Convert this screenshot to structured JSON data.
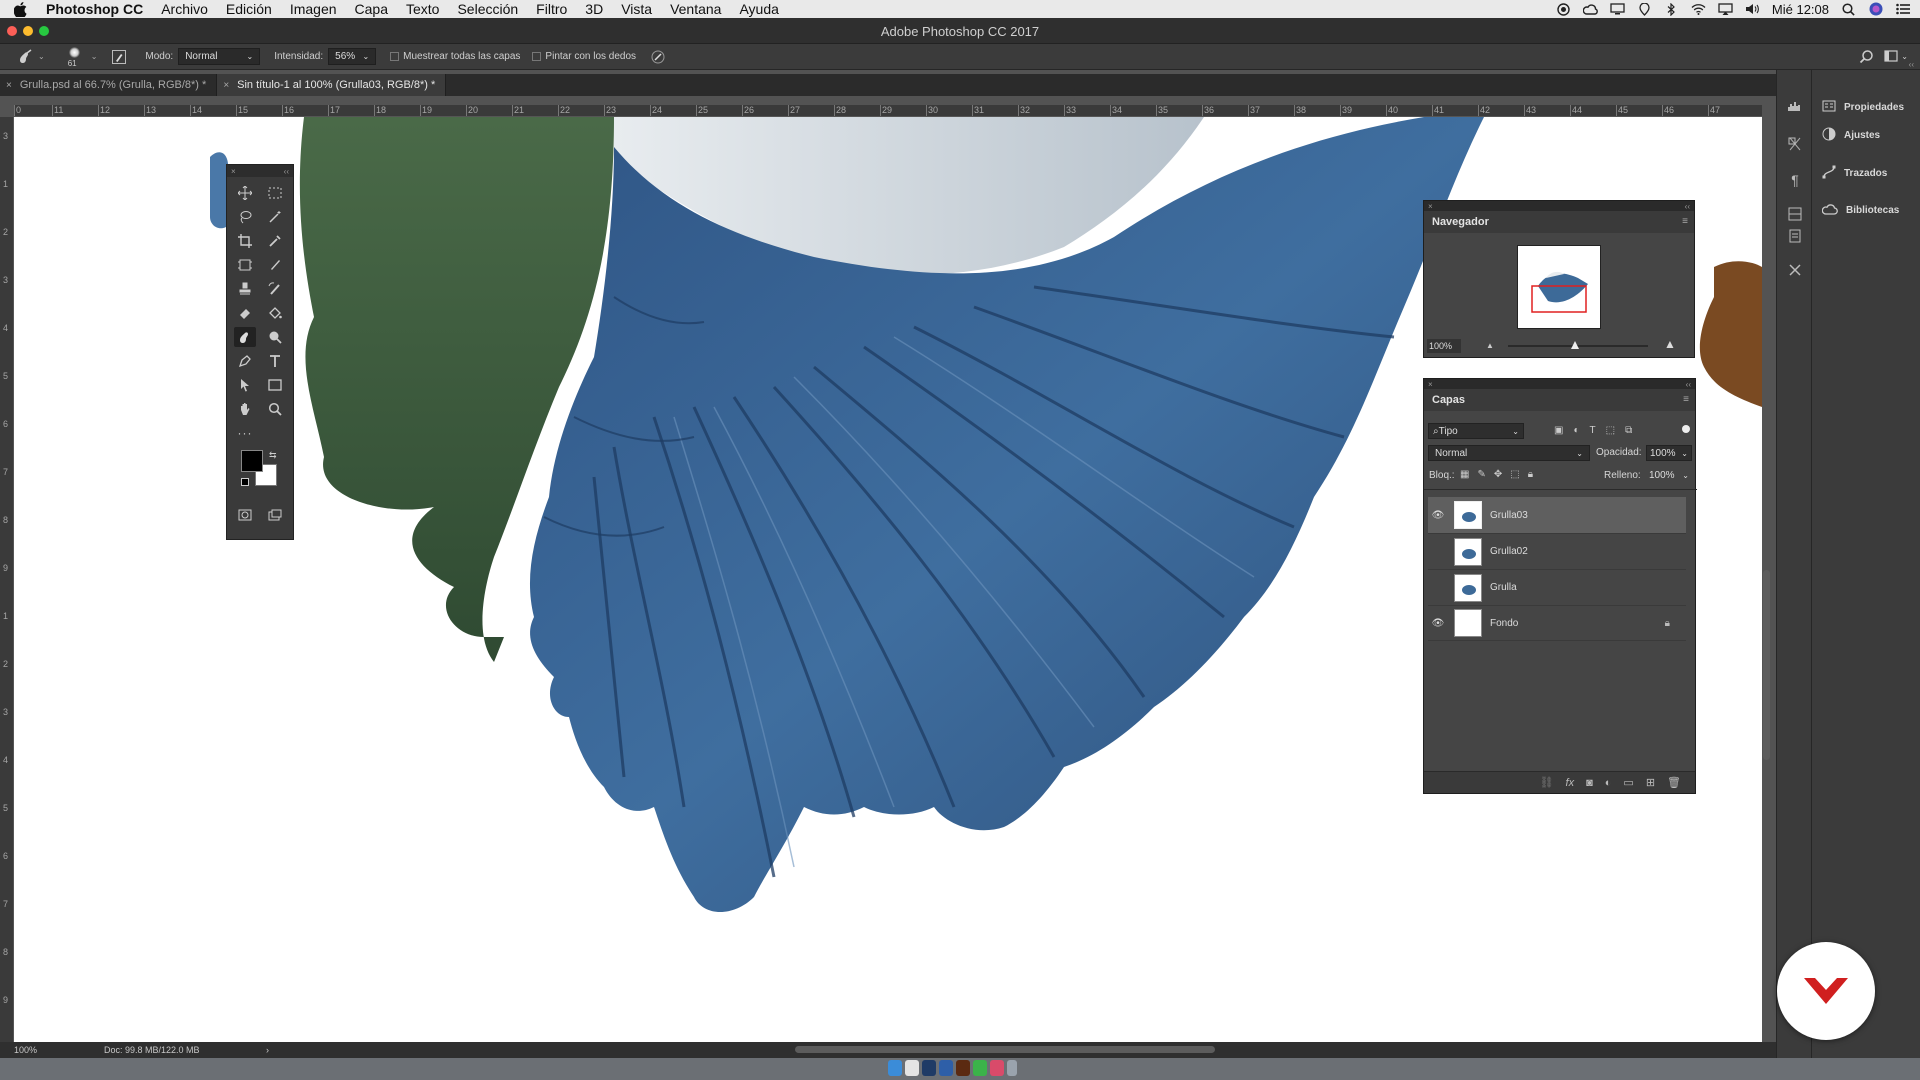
{
  "menubar": {
    "app": "Photoshop CC",
    "items": [
      "Archivo",
      "Edición",
      "Imagen",
      "Capa",
      "Texto",
      "Selección",
      "Filtro",
      "3D",
      "Vista",
      "Ventana",
      "Ayuda"
    ],
    "clock": "Mié 12:08"
  },
  "window": {
    "title": "Adobe Photoshop CC 2017"
  },
  "options": {
    "brush_size": "61",
    "mode_label": "Modo:",
    "mode_value": "Normal",
    "intensity_label": "Intensidad:",
    "intensity_value": "56%",
    "sample_all_label": "Muestrear todas las capas",
    "finger_paint_label": "Pintar con los dedos"
  },
  "tabs": [
    {
      "label": "Grulla.psd al 66.7% (Grulla, RGB/8*) *",
      "active": false
    },
    {
      "label": "Sin título-1 al 100% (Grulla03, RGB/8*) *",
      "active": true
    }
  ],
  "ruler_h": [
    "0",
    "11",
    "12",
    "13",
    "14",
    "15",
    "16",
    "17",
    "18",
    "19",
    "20",
    "21",
    "22",
    "23",
    "24",
    "25",
    "26",
    "27",
    "28",
    "29",
    "30",
    "31",
    "32",
    "33",
    "34",
    "35",
    "36",
    "37",
    "38",
    "39",
    "40",
    "41",
    "42",
    "43",
    "44",
    "45",
    "46",
    "47"
  ],
  "ruler_v": [
    "3",
    "1",
    "2",
    "3",
    "4",
    "5",
    "6",
    "7",
    "8",
    "9",
    "1",
    "2",
    "3",
    "4",
    "5",
    "6",
    "7",
    "8",
    "9"
  ],
  "status": {
    "zoom": "100%",
    "doc": "Doc: 99.8 MB/122.0 MB",
    "arrow": "›"
  },
  "navigator": {
    "title": "Navegador",
    "zoom": "100%"
  },
  "layers": {
    "title": "Capas",
    "filter": "Tipo",
    "blend": "Normal",
    "opacity_label": "Opacidad:",
    "opacity_value": "100%",
    "lock_label": "Bloq.:",
    "fill_label": "Relleno:",
    "fill_value": "100%",
    "items": [
      {
        "name": "Grulla03",
        "visible": true,
        "selected": true,
        "locked": false
      },
      {
        "name": "Grulla02",
        "visible": false,
        "selected": false,
        "locked": false
      },
      {
        "name": "Grulla",
        "visible": false,
        "selected": false,
        "locked": false
      },
      {
        "name": "Fondo",
        "visible": true,
        "selected": false,
        "locked": true
      }
    ]
  },
  "right_panel": [
    {
      "label": "Propiedades",
      "icon": "properties-icon"
    },
    {
      "label": "Ajustes",
      "icon": "adjustments-icon"
    },
    {
      "label": "Trazados",
      "icon": "paths-icon"
    },
    {
      "label": "Bibliotecas",
      "icon": "libraries-icon"
    }
  ],
  "colors": {
    "wing_blue": "#3d6a98",
    "wing_dark": "#24446b",
    "wing_green": "#3d5a3c",
    "brand_red": "#d01f1f",
    "selection_red": "#e02020"
  }
}
